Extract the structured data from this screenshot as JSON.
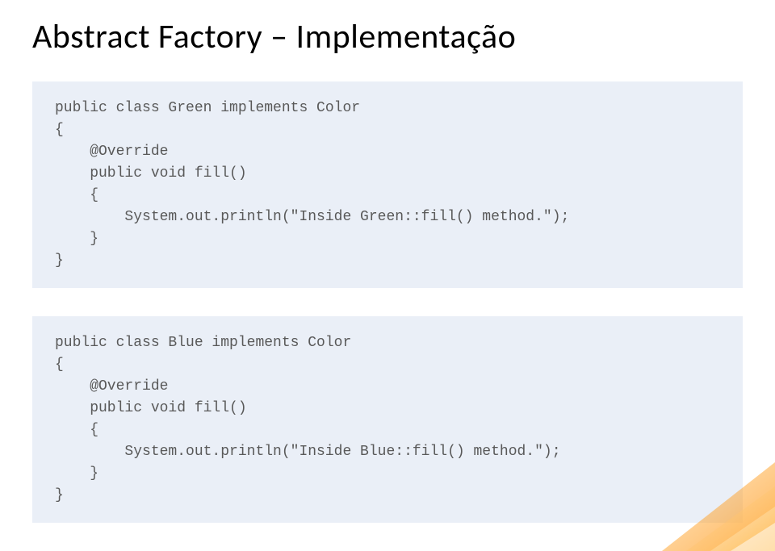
{
  "title": "Abstract Factory – Implementação",
  "code1": {
    "line1": "public class Green implements Color",
    "line2": "{",
    "line3": "    @Override",
    "line4": "    public void fill()",
    "line5": "    {",
    "line6": "        System.out.println(\"Inside Green::fill() method.\");",
    "line7": "    }",
    "line8": "}"
  },
  "code2": {
    "line1": "public class Blue implements Color",
    "line2": "{",
    "line3": "    @Override",
    "line4": "    public void fill()",
    "line5": "    {",
    "line6": "        System.out.println(\"Inside Blue::fill() method.\");",
    "line7": "    }",
    "line8": "}"
  }
}
